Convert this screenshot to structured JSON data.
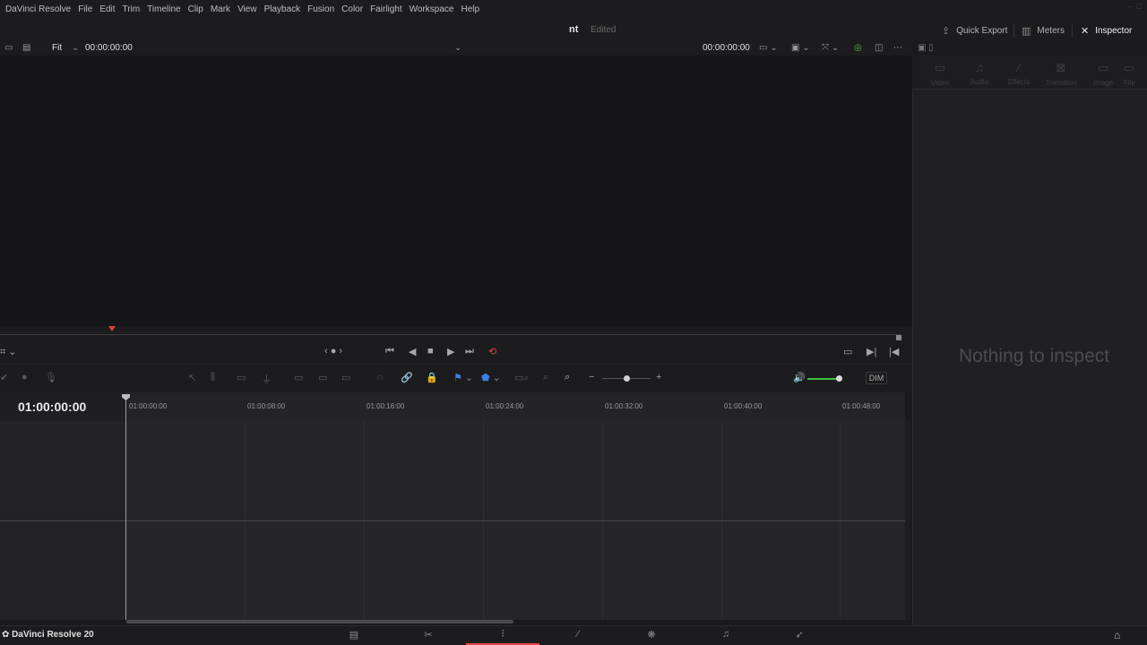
{
  "menu": [
    "DaVinci Resolve",
    "File",
    "Edit",
    "Trim",
    "Timeline",
    "Clip",
    "Mark",
    "View",
    "Playback",
    "Fusion",
    "Color",
    "Fairlight",
    "Workspace",
    "Help"
  ],
  "project": {
    "name": "nt",
    "status": "Edited"
  },
  "toolbar_right": {
    "quick_export": "Quick Export",
    "meters": "Meters",
    "inspector": "Inspector"
  },
  "viewer": {
    "zoom": "Fit",
    "source_timecode": "00:00:00:00",
    "program_timecode": "00:00:00:00"
  },
  "timeline": {
    "current_timecode": "01:00:00:00",
    "ruler_ticks": [
      "01:00:00:00",
      "01:00:08:00",
      "01:00:16:00",
      "01:00:24:00",
      "01:00:32:00",
      "01:00:40:00",
      "01:00:48:00"
    ],
    "dim_label": "DIM"
  },
  "inspector": {
    "tabs": [
      "Video",
      "Audio",
      "Effects",
      "Transition",
      "Image",
      "File"
    ],
    "empty_message": "Nothing to inspect"
  },
  "app_badge": "DaVinci Resolve 20",
  "colors": {
    "accent_red": "#e04848",
    "flag_blue": "#3d82e0",
    "volume_green": "#3fbf3f"
  }
}
